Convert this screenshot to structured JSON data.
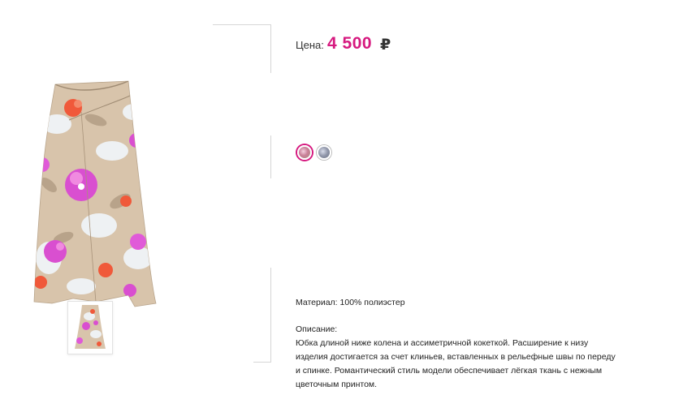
{
  "product": {
    "price_label": "Цена:",
    "price_value": "4 500",
    "currency_symbol": "₽",
    "price_color": "#d6197f",
    "main_image_alt": "floral-skirt-photo",
    "thumbnail_alt": "floral-skirt-thumbnail"
  },
  "swatches": [
    {
      "name": "pink-floral",
      "color": "#c99a9a",
      "selected": true
    },
    {
      "name": "blue-floral",
      "color": "#8f95a8",
      "selected": false
    }
  ],
  "details": {
    "material": "Материал: 100% полиэстер",
    "description_heading": "Описание:",
    "description_lines": [
      "Юбка длиной ниже колена и ассиметричной кокеткой. Расширение к низу",
      "изделия  достигается за счет  клиньев, вставленных в рельефные швы по переду",
      "и спинке. Романтический стиль модели обеспечивает лёгкая ткань с нежным",
      "цветочным принтом."
    ]
  }
}
